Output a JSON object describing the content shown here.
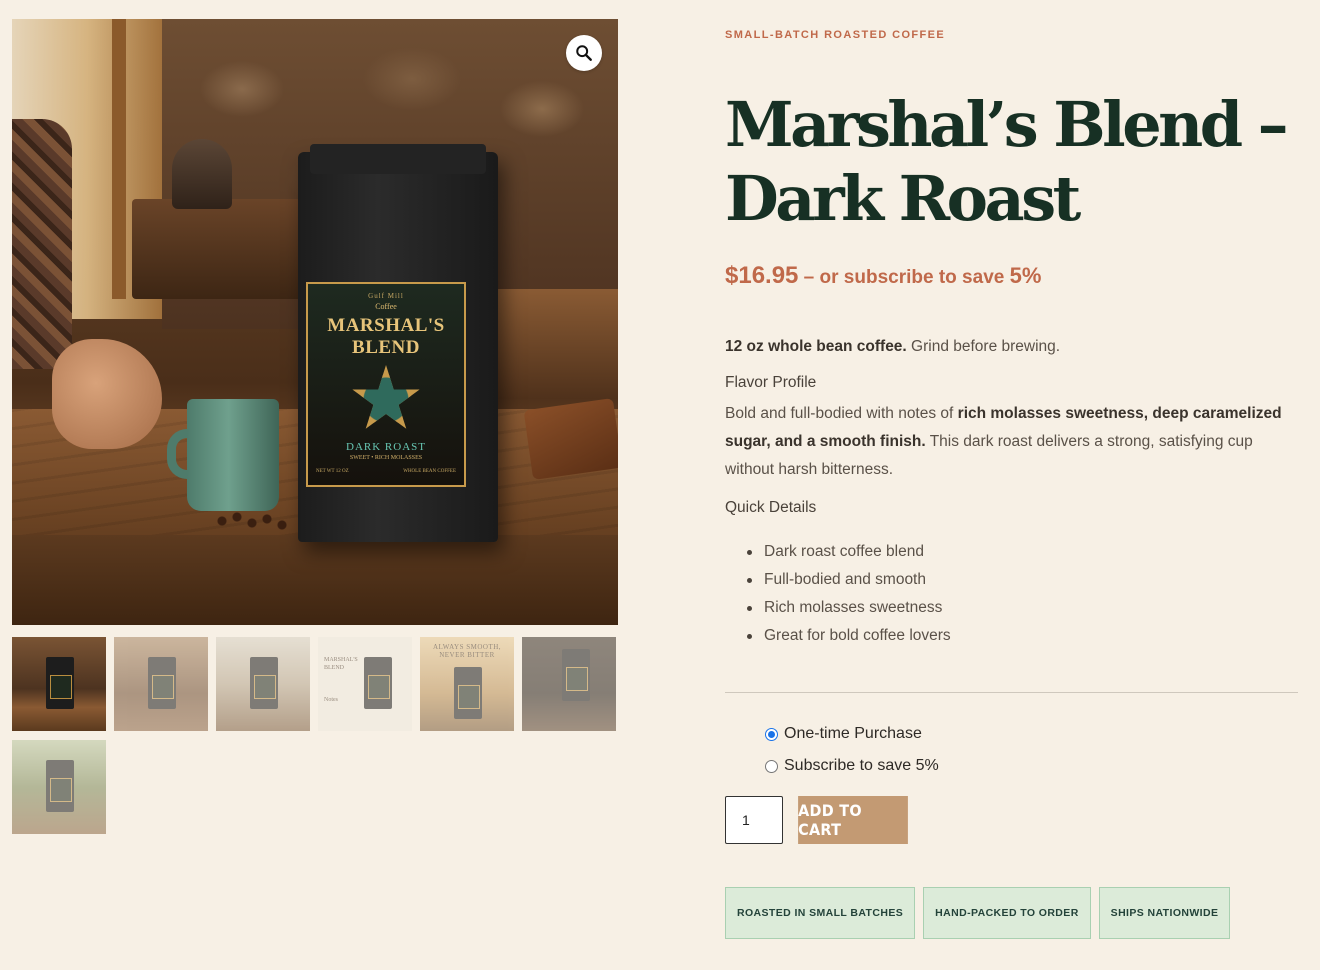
{
  "gallery": {
    "zoom_icon": "magnifier-icon",
    "bag_label": {
      "top_text": "Gulf Mill",
      "sub_text": "Coffee",
      "title": "MARSHAL'S BLEND",
      "roast": "DARK ROAST",
      "tagline": "SWEET • RICH MOLASSES",
      "foot_left": "NET WT 12 OZ",
      "foot_right": "WHOLE BEAN COFFEE"
    },
    "thumbnails": [
      {
        "id": 1
      },
      {
        "id": 2
      },
      {
        "id": 3
      },
      {
        "id": 4,
        "text": "MARSHAL'S BLEND",
        "note": "Notes"
      },
      {
        "id": 5,
        "text": "ALWAYS SMOOTH, NEVER BITTER"
      },
      {
        "id": 6
      },
      {
        "id": 7
      }
    ]
  },
  "product": {
    "eyebrow": "SMALL-BATCH ROASTED COFFEE",
    "title": "Marshal’s Blend – Dark Roast",
    "price": "$16.95",
    "subscribe_text": " – or subscribe to save ",
    "subscribe_pct": "5%",
    "summary_bold": "12 oz whole bean coffee.",
    "summary_rest": " Grind before brewing.",
    "flavor_heading": "Flavor Profile",
    "flavor_intro": "Bold and full-bodied with notes of ",
    "flavor_bold": "rich molasses sweetness, deep caramelized sugar, and a smooth finish.",
    "flavor_rest": " This dark roast delivers a strong, satisfying cup without harsh bitterness.",
    "quick_heading": "Quick Details",
    "quick_details": [
      "Dark roast coffee blend",
      "Full-bodied and smooth",
      "Rich molasses sweetness",
      "Great for bold coffee lovers"
    ]
  },
  "purchase": {
    "options": [
      {
        "label": "One-time Purchase",
        "selected": true
      },
      {
        "label": "Subscribe to save 5%",
        "selected": false
      }
    ],
    "quantity": "1",
    "add_to_cart": "ADD TO CART"
  },
  "badges": [
    "ROASTED IN SMALL BATCHES",
    "HAND-PACKED TO ORDER",
    "SHIPS NATIONWIDE"
  ],
  "colors": {
    "background": "#f7f0e5",
    "accent": "#c0694a",
    "title": "#173024",
    "button": "#c39a73",
    "chip_bg": "#dcebd9"
  }
}
